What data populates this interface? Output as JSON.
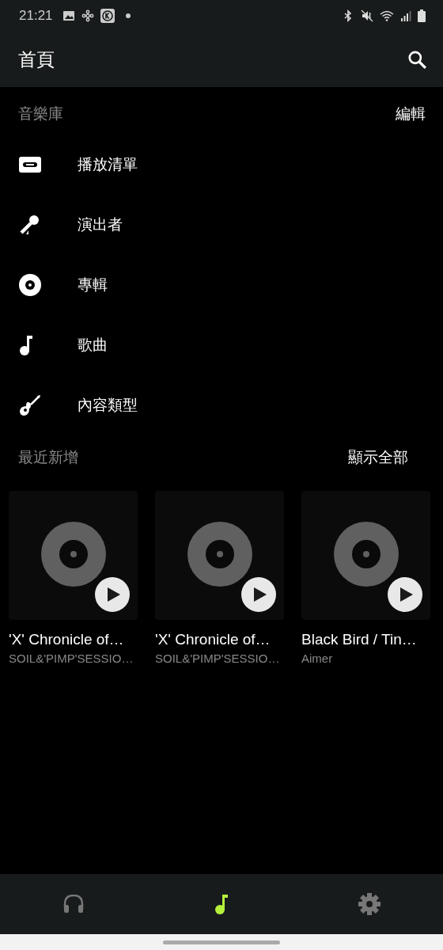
{
  "status_bar": {
    "time": "21:21"
  },
  "app_bar": {
    "title": "首頁"
  },
  "library": {
    "title": "音樂庫",
    "edit": "編輯",
    "items": [
      {
        "kind": "playlist",
        "label": "播放清單"
      },
      {
        "kind": "artist",
        "label": "演出者"
      },
      {
        "kind": "album",
        "label": "專輯"
      },
      {
        "kind": "song",
        "label": "歌曲"
      },
      {
        "kind": "genre",
        "label": "內容類型"
      }
    ]
  },
  "recent": {
    "title": "最近新增",
    "show_all": "顯示全部",
    "albums": [
      {
        "title": "'X' Chronicle of…",
        "artist": "SOIL&'PIMP'SESSIO…"
      },
      {
        "title": "'X' Chronicle of…",
        "artist": "SOIL&'PIMP'SESSIO…"
      },
      {
        "title": "Black Bird / Tin…",
        "artist": "Aimer"
      }
    ]
  },
  "bottom_nav": [
    {
      "kind": "headphones",
      "selected": false
    },
    {
      "kind": "music",
      "selected": true
    },
    {
      "kind": "settings",
      "selected": false
    }
  ]
}
